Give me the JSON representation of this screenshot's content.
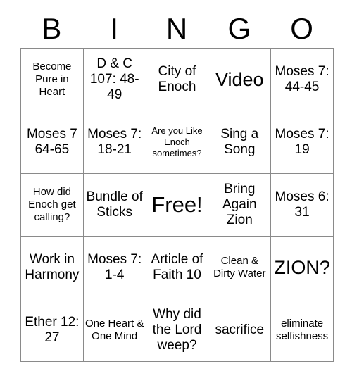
{
  "header": {
    "letters": [
      "B",
      "I",
      "N",
      "G",
      "O"
    ]
  },
  "grid": {
    "columns": 5,
    "rows": 5,
    "free_space_label": "Free!",
    "cells": [
      [
        {
          "text": "Become Pure in Heart",
          "size": "sm"
        },
        {
          "text": "D & C 107: 48-49",
          "size": "md"
        },
        {
          "text": "City of Enoch",
          "size": "md"
        },
        {
          "text": "Video",
          "size": "lg"
        },
        {
          "text": "Moses 7: 44-45",
          "size": "md"
        }
      ],
      [
        {
          "text": "Moses 7 64-65",
          "size": "md"
        },
        {
          "text": "Moses 7: 18-21",
          "size": "md"
        },
        {
          "text": "Are you Like Enoch sometimes?",
          "size": "xs"
        },
        {
          "text": "Sing a Song",
          "size": "md"
        },
        {
          "text": "Moses 7: 19",
          "size": "md"
        }
      ],
      [
        {
          "text": "How did Enoch get calling?",
          "size": "sm"
        },
        {
          "text": "Bundle of Sticks",
          "size": "md"
        },
        {
          "text": "Free!",
          "size": "xl"
        },
        {
          "text": "Bring Again Zion",
          "size": "md"
        },
        {
          "text": "Moses 6: 31",
          "size": "md"
        }
      ],
      [
        {
          "text": "Work in Harmony",
          "size": "md"
        },
        {
          "text": "Moses 7: 1-4",
          "size": "md"
        },
        {
          "text": "Article of Faith 10",
          "size": "md"
        },
        {
          "text": "Clean & Dirty Water",
          "size": "sm"
        },
        {
          "text": "ZION?",
          "size": "lg"
        }
      ],
      [
        {
          "text": "Ether 12: 27",
          "size": "md"
        },
        {
          "text": "One Heart & One Mind",
          "size": "sm"
        },
        {
          "text": "Why did the Lord weep?",
          "size": "md"
        },
        {
          "text": "sacrifice",
          "size": "md"
        },
        {
          "text": "eliminate selfishness",
          "size": "sm"
        }
      ]
    ]
  },
  "colors": {
    "background": "#ffffff",
    "text": "#000000",
    "grid_outer_border": "#4d4d4d",
    "grid_inner_border": "#8a8a8a"
  }
}
